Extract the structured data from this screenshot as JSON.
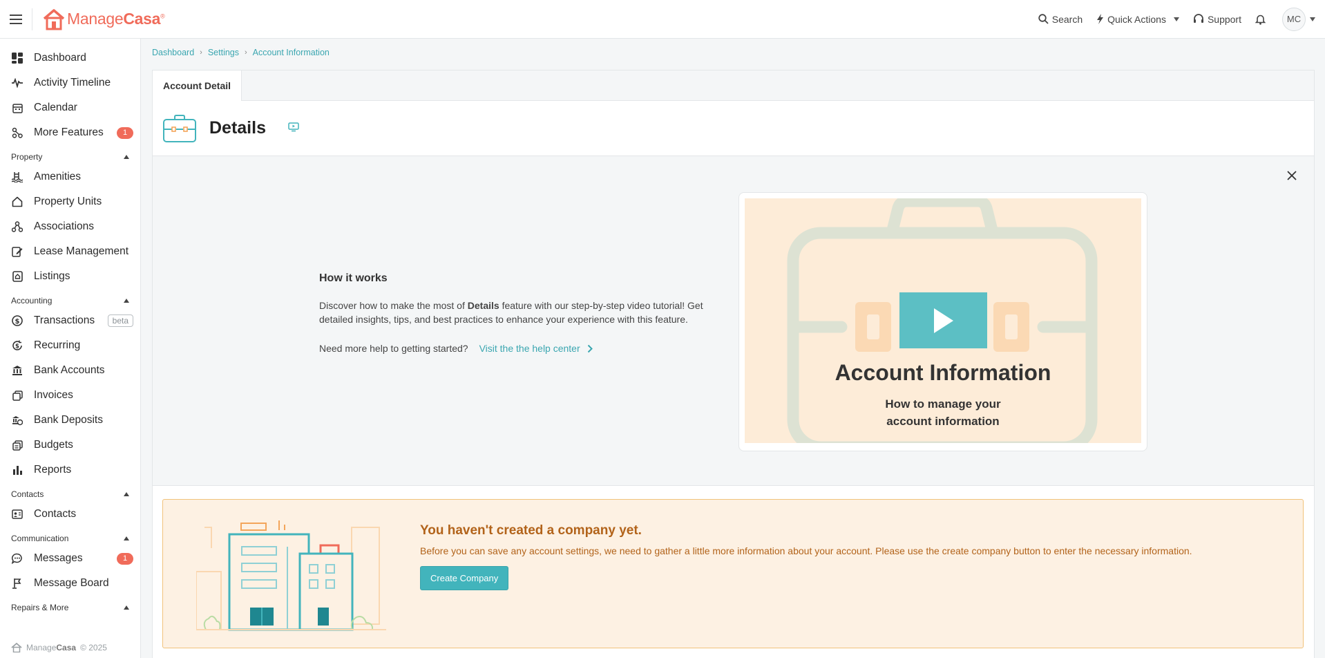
{
  "app": {
    "logo_part1": "Manage",
    "logo_part2": "Casa",
    "logo_reg": "®"
  },
  "topbar": {
    "search": "Search",
    "quick_actions": "Quick Actions",
    "support": "Support",
    "avatar_initials": "MC"
  },
  "sidebar": {
    "items": [
      {
        "label": "Dashboard",
        "icon": "dashboard-icon"
      },
      {
        "label": "Activity Timeline",
        "icon": "pulse-icon"
      },
      {
        "label": "Calendar",
        "icon": "calendar-icon"
      },
      {
        "label": "More Features",
        "icon": "nodes-icon",
        "badge": "1"
      }
    ],
    "sections": [
      {
        "title": "Property",
        "items": [
          {
            "label": "Amenities",
            "icon": "pool-icon"
          },
          {
            "label": "Property Units",
            "icon": "home-icon"
          },
          {
            "label": "Associations",
            "icon": "associations-icon"
          },
          {
            "label": "Lease Management",
            "icon": "edit-doc-icon"
          },
          {
            "label": "Listings",
            "icon": "listing-icon"
          }
        ]
      },
      {
        "title": "Accounting",
        "items": [
          {
            "label": "Transactions",
            "icon": "dollar-circle-icon",
            "beta": "beta"
          },
          {
            "label": "Recurring",
            "icon": "recurring-dollar-icon"
          },
          {
            "label": "Bank Accounts",
            "icon": "bank-icon"
          },
          {
            "label": "Invoices",
            "icon": "invoices-icon"
          },
          {
            "label": "Bank Deposits",
            "icon": "deposit-icon"
          },
          {
            "label": "Budgets",
            "icon": "budget-icon"
          },
          {
            "label": "Reports",
            "icon": "bar-chart-icon"
          }
        ]
      },
      {
        "title": "Contacts",
        "items": [
          {
            "label": "Contacts",
            "icon": "contact-card-icon"
          }
        ]
      },
      {
        "title": "Communication",
        "items": [
          {
            "label": "Messages",
            "icon": "chat-icon",
            "badge": "1"
          },
          {
            "label": "Message Board",
            "icon": "message-board-icon"
          }
        ]
      },
      {
        "title": "Repairs & More",
        "items": []
      }
    ],
    "footer_brand_a": "Manage",
    "footer_brand_b": "Casa",
    "footer_year": "© 2025"
  },
  "breadcrumb": [
    "Dashboard",
    "Settings",
    "Account Information"
  ],
  "tab": "Account Detail",
  "details": {
    "title": "Details"
  },
  "how_it_works": {
    "title": "How it works",
    "desc_before": "Discover how to make the most of ",
    "desc_bold": "Details",
    "desc_after": " feature with our step-by-step video tutorial! Get detailed insights, tips, and best practices to enhance your experience with this feature.",
    "help_prompt": "Need more help to getting started?",
    "help_link": "Visit the the help center"
  },
  "video": {
    "title": "Account Information",
    "subtitle_line1": "How to manage your",
    "subtitle_line2": "account information"
  },
  "company": {
    "title": "You haven't created a company yet.",
    "desc": "Before you can save any account settings, we need to gather a little more information about your account. Please use the create company button to enter the necessary information.",
    "button": "Create Company"
  },
  "colors": {
    "brand": "#f06b5a",
    "accent": "#42b4bc",
    "warning_text": "#b2631a",
    "warning_bg": "#fdf1e3"
  }
}
